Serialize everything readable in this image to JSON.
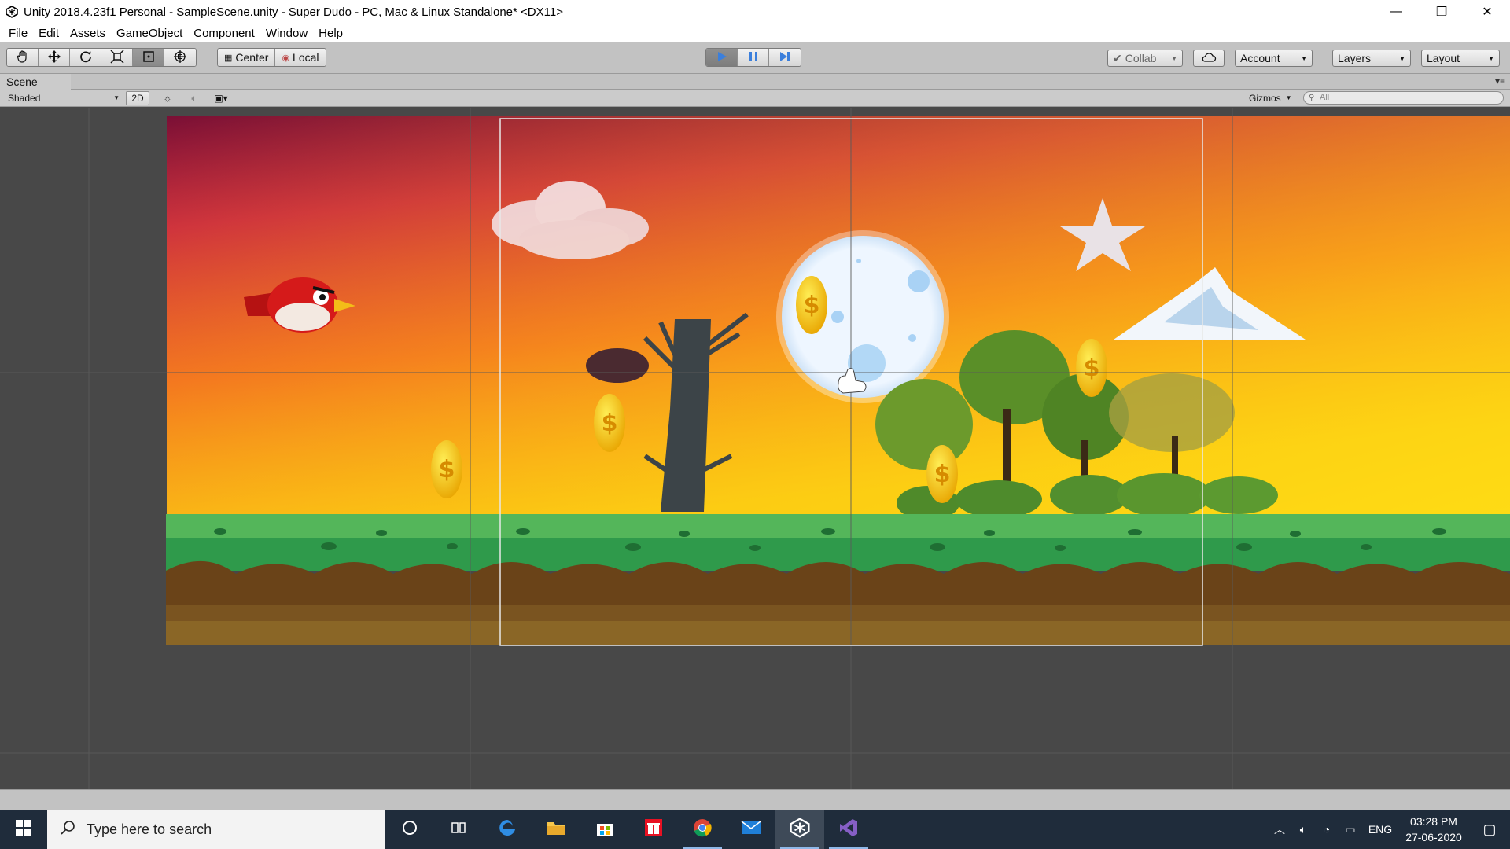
{
  "window": {
    "title": "Unity 2018.4.23f1 Personal - SampleScene.unity - Super Dudo - PC, Mac & Linux Standalone* <DX11>",
    "minimize_glyph": "—",
    "restore_glyph": "❐",
    "close_glyph": "✕"
  },
  "menu": {
    "items": [
      "File",
      "Edit",
      "Assets",
      "GameObject",
      "Component",
      "Window",
      "Help"
    ]
  },
  "toolbar": {
    "tools": [
      "hand-tool",
      "move-tool",
      "rotate-tool",
      "scale-tool",
      "rect-tool",
      "transform-tool"
    ],
    "pivot_label": "Center",
    "space_label": "Local",
    "collab_label": "Collab",
    "account_label": "Account",
    "layers_label": "Layers",
    "layout_label": "Layout"
  },
  "scene": {
    "tab_label": "Scene",
    "shading_mode": "Shaded",
    "mode_2d_label": "2D",
    "gizmos_label": "Gizmos",
    "search_placeholder": "All"
  },
  "taskbar": {
    "search_placeholder": "Type here to search",
    "language": "ENG",
    "time": "03:28 PM",
    "date": "27-06-2020",
    "apps": [
      "cortana-icon",
      "task-view-icon",
      "edge-icon",
      "file-explorer-icon",
      "store-icon",
      "gift-icon",
      "chrome-icon",
      "mail-icon",
      "unity-icon",
      "visual-studio-icon"
    ]
  },
  "colors": {
    "accent_play": "#3b7fdc",
    "editor_chrome": "#c2c2c2",
    "scene_background": "#484848",
    "taskbar": "#1f2c3b"
  }
}
